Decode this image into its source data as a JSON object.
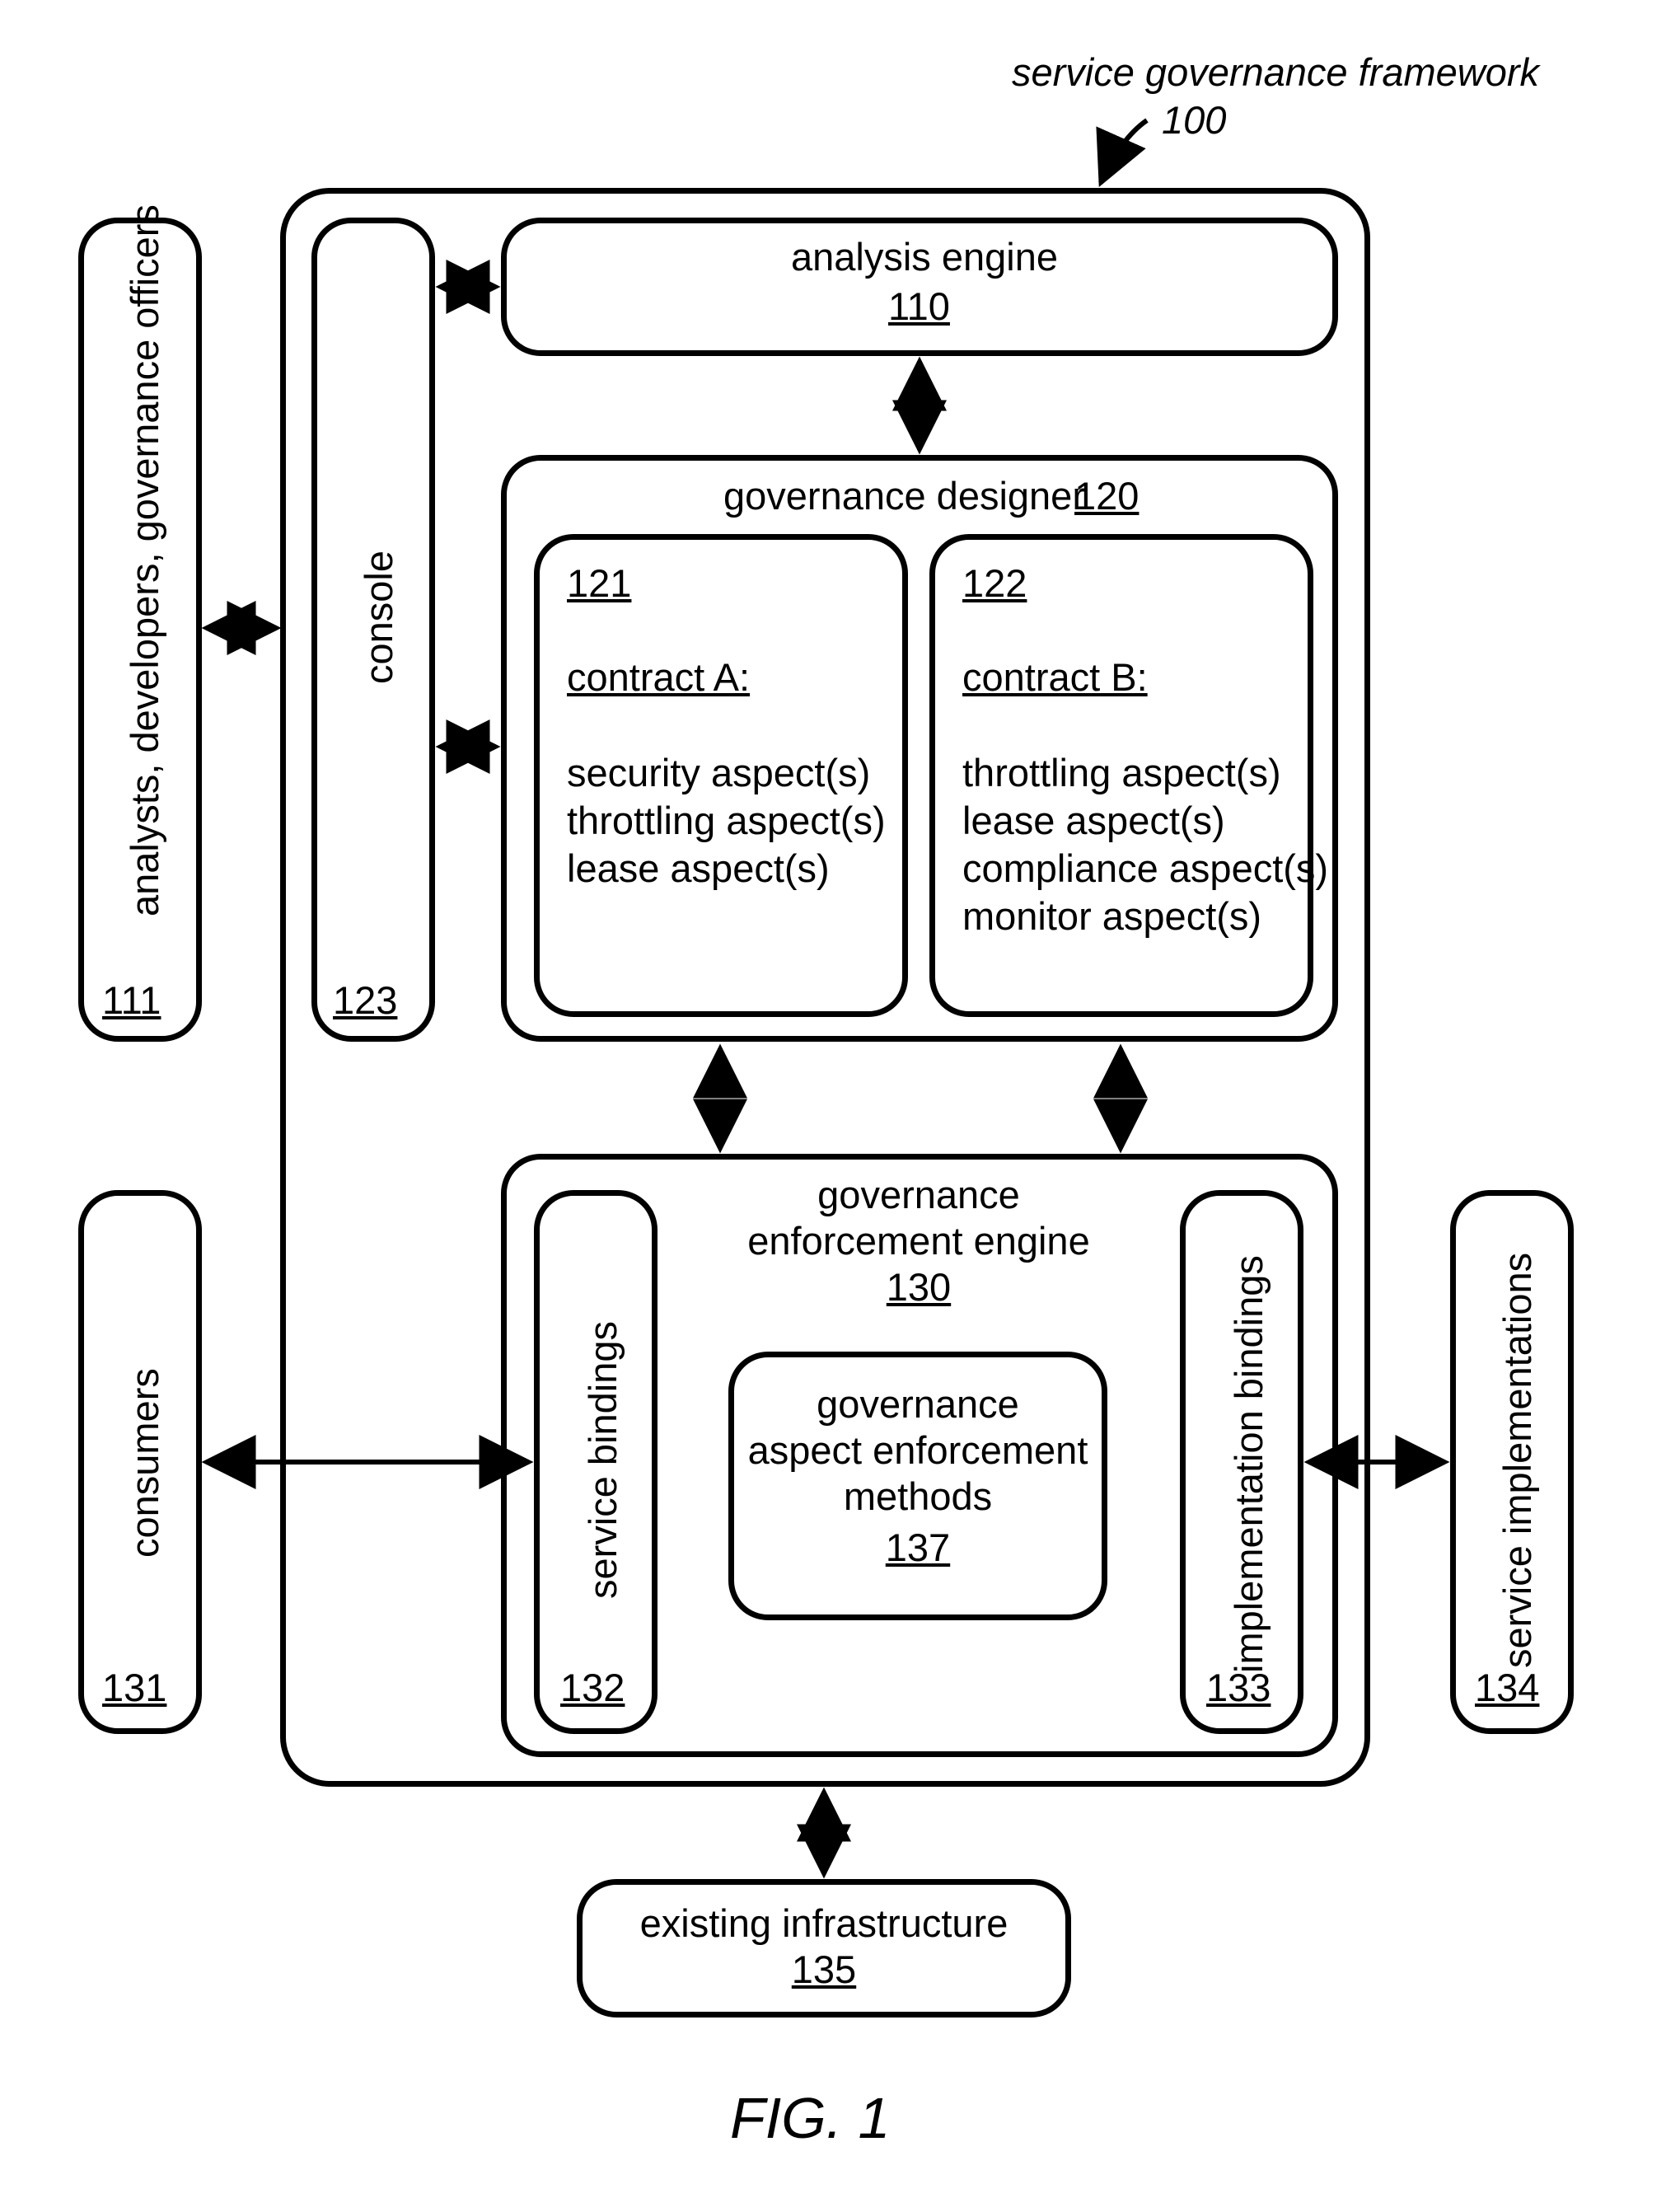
{
  "title": {
    "text": "service governance framework",
    "ref": "100"
  },
  "figure_caption": "FIG. 1",
  "left_boxes": {
    "analysts": {
      "label": "analysts, developers, governance officers",
      "ref": "111"
    },
    "consumers": {
      "label": "consumers",
      "ref": "131"
    }
  },
  "right_box": {
    "label": "service implementations",
    "ref": "134"
  },
  "bottom_box": {
    "label": "existing infrastructure",
    "ref": "135"
  },
  "framework": {
    "console": {
      "label": "console",
      "ref": "123"
    },
    "analysis_engine": {
      "label": "analysis engine",
      "ref": "110"
    },
    "designer": {
      "label": "governance designer",
      "ref": "120",
      "contract_a": {
        "ref": "121",
        "title": "contract A:",
        "aspects": [
          "security aspect(s)",
          "throttling aspect(s)",
          "lease aspect(s)"
        ]
      },
      "contract_b": {
        "ref": "122",
        "title": "contract B:",
        "aspects": [
          "throttling aspect(s)",
          "lease aspect(s)",
          "compliance aspect(s)",
          "monitor aspect(s)"
        ]
      }
    },
    "enforcement": {
      "label1": "governance",
      "label2": "enforcement engine",
      "ref": "130",
      "service_bindings": {
        "label": "service bindings",
        "ref": "132"
      },
      "impl_bindings": {
        "label": "implementation bindings",
        "ref": "133"
      },
      "methods": {
        "label1": "governance",
        "label2": "aspect enforcement",
        "label3": "methods",
        "ref": "137"
      }
    }
  }
}
